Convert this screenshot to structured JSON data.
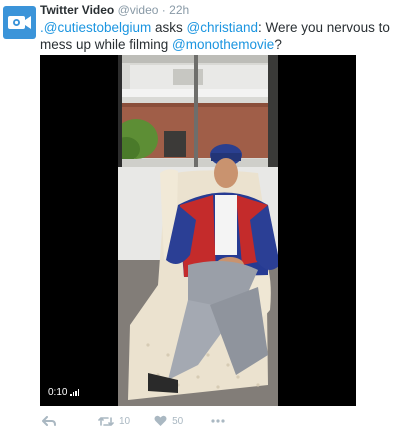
{
  "tweet": {
    "author_name": "Twitter Video",
    "author_handle": "@video",
    "separator": "·",
    "time": "22h",
    "text": {
      "mention1": ".@cutiestobelgium",
      "asks": " asks ",
      "mention2": "@christiand",
      "body": ": Were you nervous to mess up while filming ",
      "mention3": "@monothemovie",
      "end": "?"
    }
  },
  "video": {
    "timestamp": "0:10"
  },
  "actions": {
    "reply_icon": "reply-icon",
    "retweet_count": "10",
    "like_count": "50",
    "more_icon": "more-icon"
  },
  "colors": {
    "link": "#1b95e0",
    "avatar": "#3b94d9",
    "muted": "#8899a6"
  }
}
